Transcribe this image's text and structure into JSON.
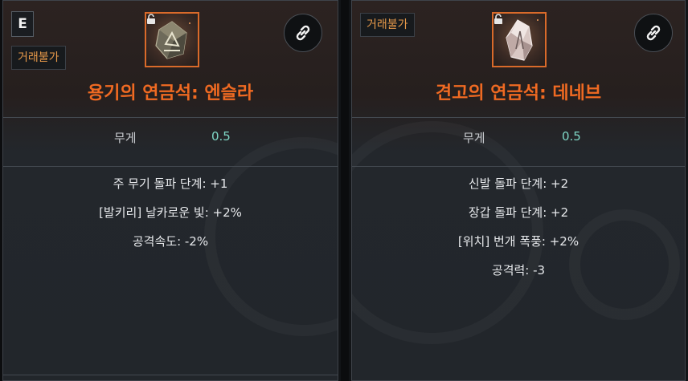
{
  "left_card": {
    "hotkey": "E",
    "trade_tag": "거래불가",
    "title": "용기의 연금석: 엔슬라",
    "weight_label": "무게",
    "weight_value": "0.5",
    "effects": [
      "주 무기 돌파 단계: +1",
      "[발키리] 날카로운 빛: +2%",
      "공격속도: -2%"
    ],
    "icon": "alchemy-stone-icon",
    "title_color": "#f06a22"
  },
  "right_card": {
    "trade_tag": "거래불가",
    "title": "견고의 연금석: 데네브",
    "weight_label": "무게",
    "weight_value": "0.5",
    "effects": [
      "신발 돌파 단계: +2",
      "장갑 돌파 단계: +2",
      "[위치] 번개 폭풍: +2%",
      "공격력: -3"
    ],
    "icon": "alchemy-stone-icon",
    "title_color": "#f06a22"
  },
  "colors": {
    "accent": "#f06a22",
    "value": "#7ed6c5",
    "tag_text": "#e89a4a"
  }
}
